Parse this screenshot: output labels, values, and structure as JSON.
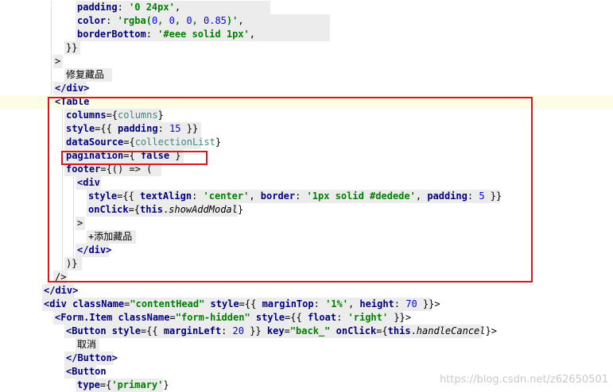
{
  "code_lines": [
    [
      [
        "t-attr",
        "padding"
      ],
      [
        "t-punc",
        ": "
      ],
      [
        "t-str",
        "'0 24px'"
      ],
      [
        "t-punc",
        ","
      ]
    ],
    [
      [
        "t-attr",
        "color"
      ],
      [
        "t-punc",
        ": "
      ],
      [
        "t-str",
        "'rgba("
      ],
      [
        "t-num",
        "0"
      ],
      [
        "t-str",
        ", "
      ],
      [
        "t-num",
        "0"
      ],
      [
        "t-str",
        ", "
      ],
      [
        "t-num",
        "0"
      ],
      [
        "t-str",
        ", "
      ],
      [
        "t-num",
        "0.85"
      ],
      [
        "t-str",
        ")'"
      ],
      [
        "t-punc",
        ","
      ]
    ],
    [
      [
        "t-attr",
        "borderBottom"
      ],
      [
        "t-punc",
        ": "
      ],
      [
        "t-str",
        "'#eee solid 1px'"
      ],
      [
        "t-punc",
        ","
      ]
    ],
    [
      [
        "t-punc",
        "}}"
      ]
    ],
    [
      [
        "t-punc",
        ">"
      ]
    ],
    [
      [
        "t-text",
        "修复藏品"
      ]
    ],
    [
      [
        "t-tag",
        "</div>"
      ]
    ],
    [
      [
        "t-tag",
        "<Table"
      ]
    ],
    [
      [
        "t-attr",
        "columns"
      ],
      [
        "t-punc",
        "={"
      ],
      [
        "t-var",
        "columns"
      ],
      [
        "t-punc",
        "}"
      ]
    ],
    [
      [
        "t-attr",
        "style"
      ],
      [
        "t-punc",
        "={{ "
      ],
      [
        "t-attr",
        "padding"
      ],
      [
        "t-punc",
        ": "
      ],
      [
        "t-num",
        "15"
      ],
      [
        "t-punc",
        " }}"
      ]
    ],
    [
      [
        "t-attr",
        "dataSource"
      ],
      [
        "t-punc",
        "={"
      ],
      [
        "t-var",
        "collectionList"
      ],
      [
        "t-punc",
        "}"
      ]
    ],
    [
      [
        "t-attr",
        "pagination"
      ],
      [
        "t-punc",
        "={ "
      ],
      [
        "t-key",
        "false"
      ],
      [
        "t-punc",
        " }"
      ]
    ],
    [
      [
        "t-attr",
        "footer"
      ],
      [
        "t-punc",
        "={() => ("
      ]
    ],
    [
      [
        "t-tag",
        "<div"
      ]
    ],
    [
      [
        "t-attr",
        "style"
      ],
      [
        "t-punc",
        "={{ "
      ],
      [
        "t-attr",
        "textAlign"
      ],
      [
        "t-punc",
        ": "
      ],
      [
        "t-str",
        "'center'"
      ],
      [
        "t-punc",
        ", "
      ],
      [
        "t-attr",
        "border"
      ],
      [
        "t-punc",
        ": "
      ],
      [
        "t-str",
        "'1px solid #dedede'"
      ],
      [
        "t-punc",
        ", "
      ],
      [
        "t-attr",
        "padding"
      ],
      [
        "t-punc",
        ": "
      ],
      [
        "t-num",
        "5"
      ],
      [
        "t-punc",
        " }}"
      ]
    ],
    [
      [
        "t-attr",
        "onClick"
      ],
      [
        "t-punc",
        "={"
      ],
      [
        "t-key",
        "this"
      ],
      [
        "t-punc",
        "."
      ],
      [
        "t-it",
        "showAddModal"
      ],
      [
        "t-punc",
        "}"
      ]
    ],
    [
      [
        "t-punc",
        ">"
      ]
    ],
    [
      [
        "t-plain",
        "+"
      ],
      [
        "t-text",
        "添加藏品"
      ]
    ],
    [
      [
        "t-tag",
        "</div>"
      ]
    ],
    [
      [
        "t-punc",
        ")}"
      ]
    ],
    [
      [
        "t-punc",
        "/>"
      ]
    ],
    [
      [
        "t-tag",
        "</div>"
      ]
    ],
    [
      [
        "t-tag",
        "<div "
      ],
      [
        "t-attr",
        "className"
      ],
      [
        "t-punc",
        "="
      ],
      [
        "t-str",
        "\"contentHead\""
      ],
      [
        "t-punc",
        " "
      ],
      [
        "t-attr",
        "style"
      ],
      [
        "t-punc",
        "={{ "
      ],
      [
        "t-attr",
        "marginTop"
      ],
      [
        "t-punc",
        ": "
      ],
      [
        "t-str",
        "'1%'"
      ],
      [
        "t-punc",
        ", "
      ],
      [
        "t-attr",
        "height"
      ],
      [
        "t-punc",
        ": "
      ],
      [
        "t-num",
        "70"
      ],
      [
        "t-punc",
        " }}>"
      ]
    ],
    [
      [
        "t-tag",
        "<Form.Item "
      ],
      [
        "t-attr",
        "className"
      ],
      [
        "t-punc",
        "="
      ],
      [
        "t-str",
        "\"form-hidden\""
      ],
      [
        "t-punc",
        " "
      ],
      [
        "t-attr",
        "style"
      ],
      [
        "t-punc",
        "={{ "
      ],
      [
        "t-attr",
        "float"
      ],
      [
        "t-punc",
        ": "
      ],
      [
        "t-str",
        "'right'"
      ],
      [
        "t-punc",
        " }}>"
      ]
    ],
    [
      [
        "t-tag",
        "<Button "
      ],
      [
        "t-attr",
        "style"
      ],
      [
        "t-punc",
        "={{ "
      ],
      [
        "t-attr",
        "marginLeft"
      ],
      [
        "t-punc",
        ": "
      ],
      [
        "t-num",
        "20"
      ],
      [
        "t-punc",
        " }} "
      ],
      [
        "t-attr",
        "key"
      ],
      [
        "t-punc",
        "="
      ],
      [
        "t-str",
        "\"back_\""
      ],
      [
        "t-punc",
        " "
      ],
      [
        "t-attr",
        "onClick"
      ],
      [
        "t-punc",
        "={"
      ],
      [
        "t-key",
        "this"
      ],
      [
        "t-punc",
        "."
      ],
      [
        "t-it",
        "handleCancel"
      ],
      [
        "t-punc",
        "}>"
      ]
    ],
    [
      [
        "t-text",
        "取消"
      ]
    ],
    [
      [
        "t-tag",
        "</Button>"
      ]
    ],
    [
      [
        "t-tag",
        "<Button"
      ]
    ],
    [
      [
        "t-attr",
        "type"
      ],
      [
        "t-punc",
        "={"
      ],
      [
        "t-str",
        "'primary'"
      ],
      [
        "t-punc",
        "}"
      ]
    ]
  ],
  "watermark": "https://blog.csdn.net/z62650501"
}
